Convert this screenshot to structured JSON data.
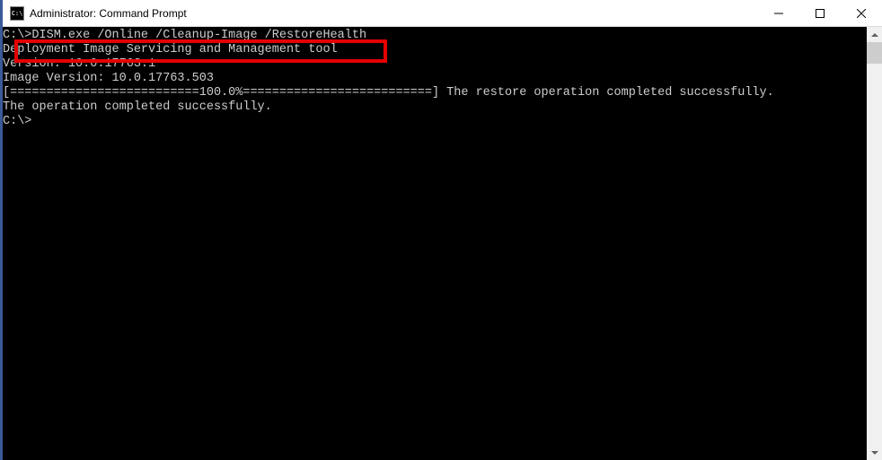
{
  "window": {
    "title": "Administrator: Command Prompt",
    "icon_label": "C:\\"
  },
  "terminal": {
    "prompt1_prefix": "C:\\>",
    "command": "DISM.exe /Online /Cleanup-Image /RestoreHealth",
    "blank1": "",
    "line_tool": "Deployment Image Servicing and Management tool",
    "line_version": "Version: 10.0.17763.1",
    "blank2": "",
    "line_image_version": "Image Version: 10.0.17763.503",
    "blank3": "",
    "line_progress": "[==========================100.0%==========================] The restore operation completed successfully.",
    "line_complete": "The operation completed successfully.",
    "blank4": "",
    "prompt2": "C:\\>"
  }
}
